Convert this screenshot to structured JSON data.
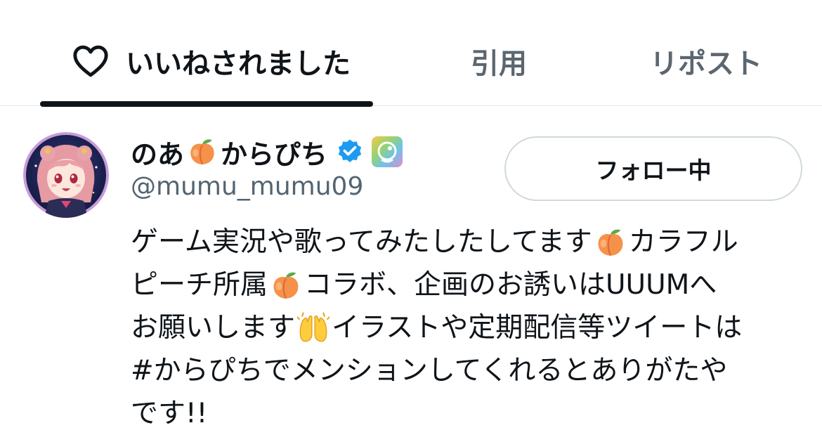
{
  "tabs": {
    "liked": "いいねされました",
    "quotes": "引用",
    "reposts": "リポスト"
  },
  "user": {
    "name_part1": "のあ",
    "name_part2": "からぴち",
    "handle": "@mumu_mumu09",
    "follow_button": "フォロー中",
    "verified_color": "#1d9bf0",
    "bio": {
      "line1_a": "ゲーム実況や歌ってみたしたしてます",
      "line1_b": "カラフル",
      "line2_a": "ピーチ所属",
      "line2_b": " コラボ、企画のお誘いはUUUMへ",
      "line3_a": "お願いします",
      "line3_b": "イラストや定期配信等ツイートは",
      "line4_hashtag": "#からぴち",
      "line4_b": " でメンションしてくれるとありがたや",
      "line5": "です!!"
    }
  },
  "icons": {
    "heart": "heart-outline-icon",
    "verified": "verified-badge-icon",
    "affiliate": "affiliate-badge-icon",
    "peach": "peach-emoji",
    "hands": "raising-hands-emoji"
  }
}
